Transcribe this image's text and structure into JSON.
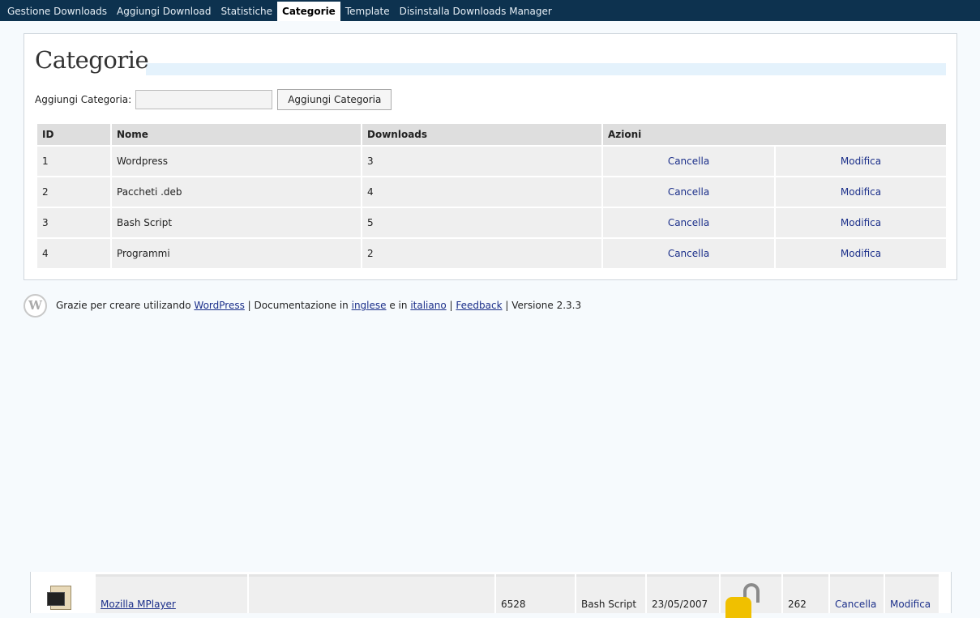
{
  "nav": {
    "items": [
      {
        "label": "Gestione Downloads",
        "active": false
      },
      {
        "label": "Aggiungi Download",
        "active": false
      },
      {
        "label": "Statistiche",
        "active": false
      },
      {
        "label": "Categorie",
        "active": true
      },
      {
        "label": "Template",
        "active": false
      },
      {
        "label": "Disinstalla Downloads Manager",
        "active": false
      }
    ]
  },
  "page": {
    "title": "Categorie",
    "add_label": "Aggiungi Categoria:",
    "add_input_value": "",
    "add_button": "Aggiungi Categoria"
  },
  "table": {
    "headers": {
      "id": "ID",
      "name": "Nome",
      "downloads": "Downloads",
      "actions": "Azioni"
    },
    "rows": [
      {
        "id": "1",
        "name": "Wordpress",
        "downloads": "3",
        "delete": "Cancella",
        "edit": "Modifica"
      },
      {
        "id": "2",
        "name": "Paccheti .deb",
        "downloads": "4",
        "delete": "Cancella",
        "edit": "Modifica"
      },
      {
        "id": "3",
        "name": "Bash Script",
        "downloads": "5",
        "delete": "Cancella",
        "edit": "Modifica"
      },
      {
        "id": "4",
        "name": "Programmi",
        "downloads": "2",
        "delete": "Cancella",
        "edit": "Modifica"
      }
    ]
  },
  "footer": {
    "logo_icon": "wordpress-logo-icon",
    "text1": "Grazie per creare utilizando",
    "link_wordpress": "WordPress",
    "text2": "| Documentazione in",
    "link_inglese": "inglese",
    "text3": "e in",
    "link_italiano": "italiano",
    "text4": "|",
    "link_feedback": "Feedback",
    "text5": "| Versione 2.3.3"
  },
  "bottom_row": {
    "file_icon": "terminal-file-icon",
    "name": "Mozilla MPlayer",
    "description": "",
    "size": "6528",
    "category": "Bash Script",
    "date": "23/05/2007",
    "lock_icon": "unlocked-padlock-icon",
    "hits": "262",
    "delete": "Cancella",
    "edit": "Modifica"
  }
}
